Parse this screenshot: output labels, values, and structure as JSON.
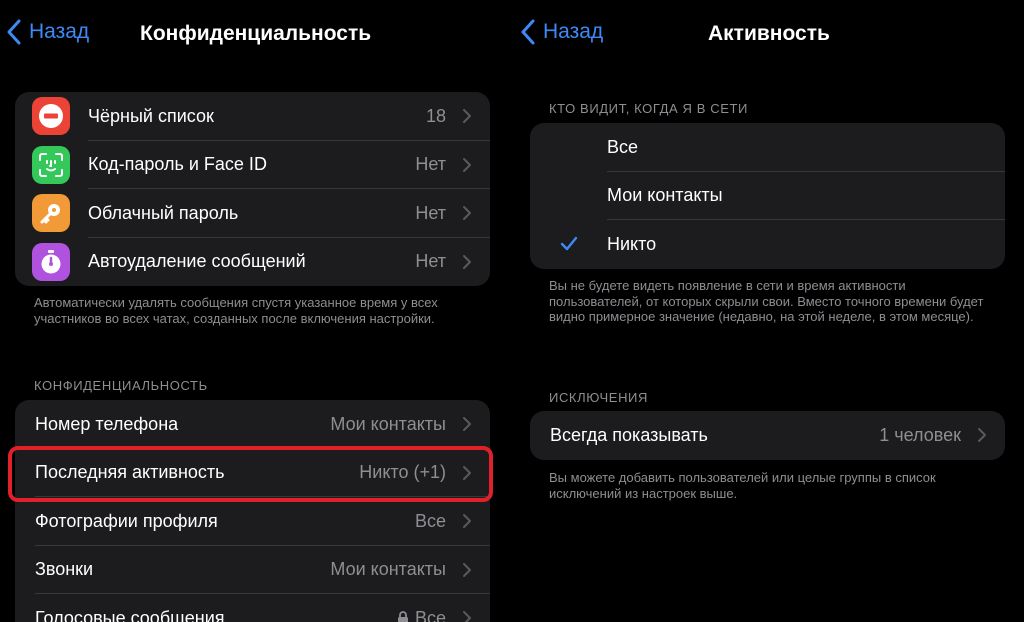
{
  "left": {
    "nav": {
      "back_label": "Назад",
      "title": "Конфиденциальность"
    },
    "security_items": [
      {
        "label": "Чёрный список",
        "value": "18",
        "icon": "blocked-icon",
        "color": "#eb4436"
      },
      {
        "label": "Код-пароль и Face ID",
        "value": "Нет",
        "icon": "face-id-icon",
        "color": "#34c759"
      },
      {
        "label": "Облачный пароль",
        "value": "Нет",
        "icon": "key-icon",
        "color": "#f19a37"
      },
      {
        "label": "Автоудаление сообщений",
        "value": "Нет",
        "icon": "timer-icon",
        "color": "#af52de"
      }
    ],
    "auto_delete_caption": "Автоматически удалять сообщения спустя указанное время у всех участников во всех чатах, созданных после включения настройки.",
    "privacy_header": "КОНФИДЕНЦИАЛЬНОСТЬ",
    "privacy_items": [
      {
        "label": "Номер телефона",
        "value": "Мои контакты"
      },
      {
        "label": "Последняя активность",
        "value": "Никто (+1)"
      },
      {
        "label": "Фотографии профиля",
        "value": "Все"
      },
      {
        "label": "Звонки",
        "value": "Мои контакты"
      },
      {
        "label": "Голосовые сообщения",
        "value": "Все",
        "locked": true
      }
    ]
  },
  "right": {
    "nav": {
      "back_label": "Назад",
      "title": "Активность"
    },
    "who_sees_header": "КТО ВИДИТ, КОГДА Я В СЕТИ",
    "options": [
      {
        "label": "Все",
        "selected": false
      },
      {
        "label": "Мои контакты",
        "selected": false
      },
      {
        "label": "Никто",
        "selected": true
      }
    ],
    "options_caption": "Вы не будете видеть появление в сети и время активности пользователей, от которых скрыли свои. Вместо точного времени будет видно примерное значение (недавно, на этой неделе, в этом месяце).",
    "exceptions_header": "ИСКЛЮЧЕНИЯ",
    "exceptions": [
      {
        "label": "Всегда показывать",
        "value": "1 человек"
      }
    ],
    "exceptions_caption": "Вы можете добавить пользователей или целые группы в список исключений из настроек выше."
  },
  "colors": {
    "accent": "#3d8af7",
    "highlight": "#e0202a",
    "cell": "#1c1c1e",
    "secondary_text": "#8e8e93"
  }
}
